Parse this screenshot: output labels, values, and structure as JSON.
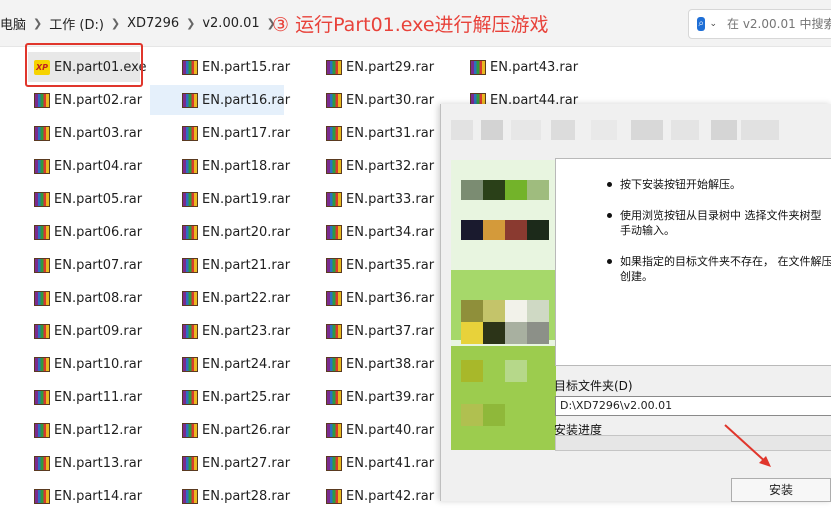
{
  "breadcrumb": [
    "电脑",
    "工作 (D:)",
    "XD7296",
    "v2.00.01"
  ],
  "annotation": "③ 运行Part01.exe进行解压游戏",
  "search": {
    "placeholder": "在 v2.00.01 中搜索"
  },
  "files": {
    "col1": [
      "EN.part01.exe",
      "EN.part02.rar",
      "EN.part03.rar",
      "EN.part04.rar",
      "EN.part05.rar",
      "EN.part06.rar",
      "EN.part07.rar",
      "EN.part08.rar",
      "EN.part09.rar",
      "EN.part10.rar",
      "EN.part11.rar",
      "EN.part12.rar",
      "EN.part13.rar",
      "EN.part14.rar"
    ],
    "col2": [
      "EN.part15.rar",
      "EN.part16.rar",
      "EN.part17.rar",
      "EN.part18.rar",
      "EN.part19.rar",
      "EN.part20.rar",
      "EN.part21.rar",
      "EN.part22.rar",
      "EN.part23.rar",
      "EN.part24.rar",
      "EN.part25.rar",
      "EN.part26.rar",
      "EN.part27.rar",
      "EN.part28.rar"
    ],
    "col3": [
      "EN.part29.rar",
      "EN.part30.rar",
      "EN.part31.rar",
      "EN.part32.rar",
      "EN.part33.rar",
      "EN.part34.rar",
      "EN.part35.rar",
      "EN.part36.rar",
      "EN.part37.rar",
      "EN.part38.rar",
      "EN.part39.rar",
      "EN.part40.rar",
      "EN.part41.rar",
      "EN.part42.rar"
    ],
    "col4": [
      "EN.part43.rar",
      "EN.part44.rar"
    ]
  },
  "exe_icon_text": "XP",
  "installer": {
    "instructions": [
      [
        "按下安装按钮开始解压。"
      ],
      [
        "使用浏览按钮从目录树中 选择文件夹树型",
        "手动输入。"
      ],
      [
        "如果指定的目标文件夹不存在， 在文件解压",
        "创建。"
      ]
    ],
    "dest_label": "目标文件夹(D)",
    "dest_path": "D:\\XD7296\\v2.00.01",
    "progress_label": "安装进度",
    "progress": 0,
    "install_button": "安装"
  },
  "colors": {
    "annotation": "#e8423a",
    "selection": "#e5f0fb",
    "dialog_bg": "#f0f0f0"
  }
}
